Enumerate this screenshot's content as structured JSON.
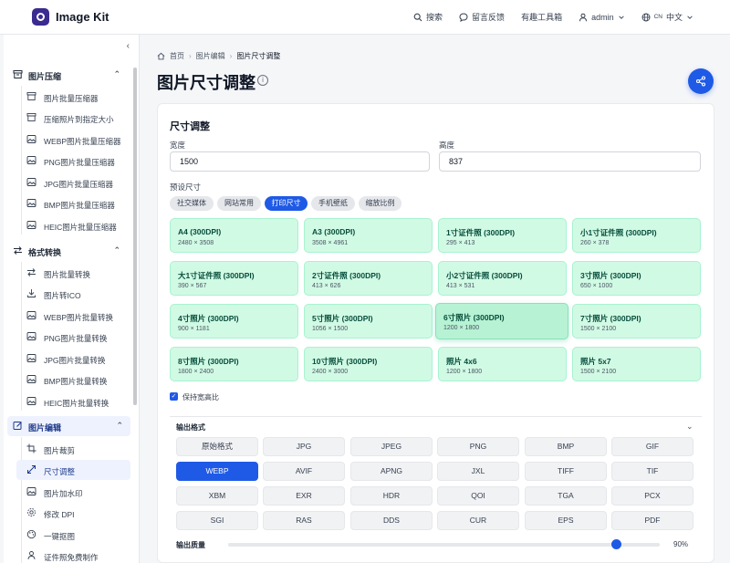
{
  "header": {
    "title": "Image Kit",
    "nav": {
      "search": "搜索",
      "feedback": "留言反馈",
      "tools": "有趣工具箱",
      "user": "admin",
      "lang_code": "CN",
      "lang": "中文"
    }
  },
  "sidebar": {
    "groups": [
      {
        "label": "图片压缩",
        "items": [
          "图片批量压缩器",
          "压缩照片到指定大小",
          "WEBP图片批量压缩器",
          "PNG图片批量压缩器",
          "JPG图片批量压缩器",
          "BMP图片批量压缩器",
          "HEIC图片批量压缩器"
        ]
      },
      {
        "label": "格式转换",
        "items": [
          "图片批量转换",
          "图片转ICO",
          "WEBP图片批量转换",
          "PNG图片批量转换",
          "JPG图片批量转换",
          "BMP图片批量转换",
          "HEIC图片批量转换"
        ]
      },
      {
        "label": "图片编辑",
        "items": [
          "图片裁剪",
          "尺寸调整",
          "图片加水印",
          "修改 DPI",
          "一键抠图",
          "证件照免费制作"
        ]
      }
    ]
  },
  "breadcrumb": {
    "home": "首页",
    "parent": "图片编辑",
    "current": "图片尺寸调整"
  },
  "page": {
    "title": "图片尺寸调整"
  },
  "card": {
    "title": "尺寸调整",
    "width_label": "宽度",
    "width_value": "1500",
    "height_label": "高度",
    "height_value": "837",
    "preset_label": "预设尺寸",
    "preset_tabs": [
      "社交媒体",
      "网站常用",
      "打印尺寸",
      "手机壁纸",
      "缩放比例"
    ],
    "presets": [
      {
        "name": "A4 (300DPI)",
        "dims": "2480 × 3508"
      },
      {
        "name": "A3 (300DPI)",
        "dims": "3508 × 4961"
      },
      {
        "name": "1寸证件照 (300DPI)",
        "dims": "295 × 413"
      },
      {
        "name": "小1寸证件照 (300DPI)",
        "dims": "260 × 378"
      },
      {
        "name": "大1寸证件照 (300DPI)",
        "dims": "390 × 567"
      },
      {
        "name": "2寸证件照 (300DPI)",
        "dims": "413 × 626"
      },
      {
        "name": "小2寸证件照 (300DPI)",
        "dims": "413 × 531"
      },
      {
        "name": "3寸照片 (300DPI)",
        "dims": "650 × 1000"
      },
      {
        "name": "4寸照片 (300DPI)",
        "dims": "900 × 1181"
      },
      {
        "name": "5寸照片 (300DPI)",
        "dims": "1056 × 1500"
      },
      {
        "name": "6寸照片 (300DPI)",
        "dims": "1200 × 1800"
      },
      {
        "name": "7寸照片 (300DPI)",
        "dims": "1500 × 2100"
      },
      {
        "name": "8寸照片 (300DPI)",
        "dims": "1800 × 2400"
      },
      {
        "name": "10寸照片 (300DPI)",
        "dims": "2400 × 3000"
      },
      {
        "name": "照片 4x6",
        "dims": "1200 × 1800"
      },
      {
        "name": "照片 5x7",
        "dims": "1500 × 2100"
      }
    ],
    "keep_ratio_label": "保持宽高比",
    "output_format_label": "输出格式",
    "formats": [
      "原始格式",
      "JPG",
      "JPEG",
      "PNG",
      "BMP",
      "GIF",
      "WEBP",
      "AVIF",
      "APNG",
      "JXL",
      "TIFF",
      "TIF",
      "XBM",
      "EXR",
      "HDR",
      "QOI",
      "TGA",
      "PCX",
      "SGI",
      "RAS",
      "DDS",
      "CUR",
      "EPS",
      "PDF"
    ],
    "selected_format": "WEBP",
    "quality_label": "输出质量",
    "quality_value": "90%",
    "quality_fraction": 0.9
  },
  "colors": {
    "primary": "#1f5ae6",
    "tile_bg": "#d1fae5",
    "tile_text": "#064e3b"
  }
}
